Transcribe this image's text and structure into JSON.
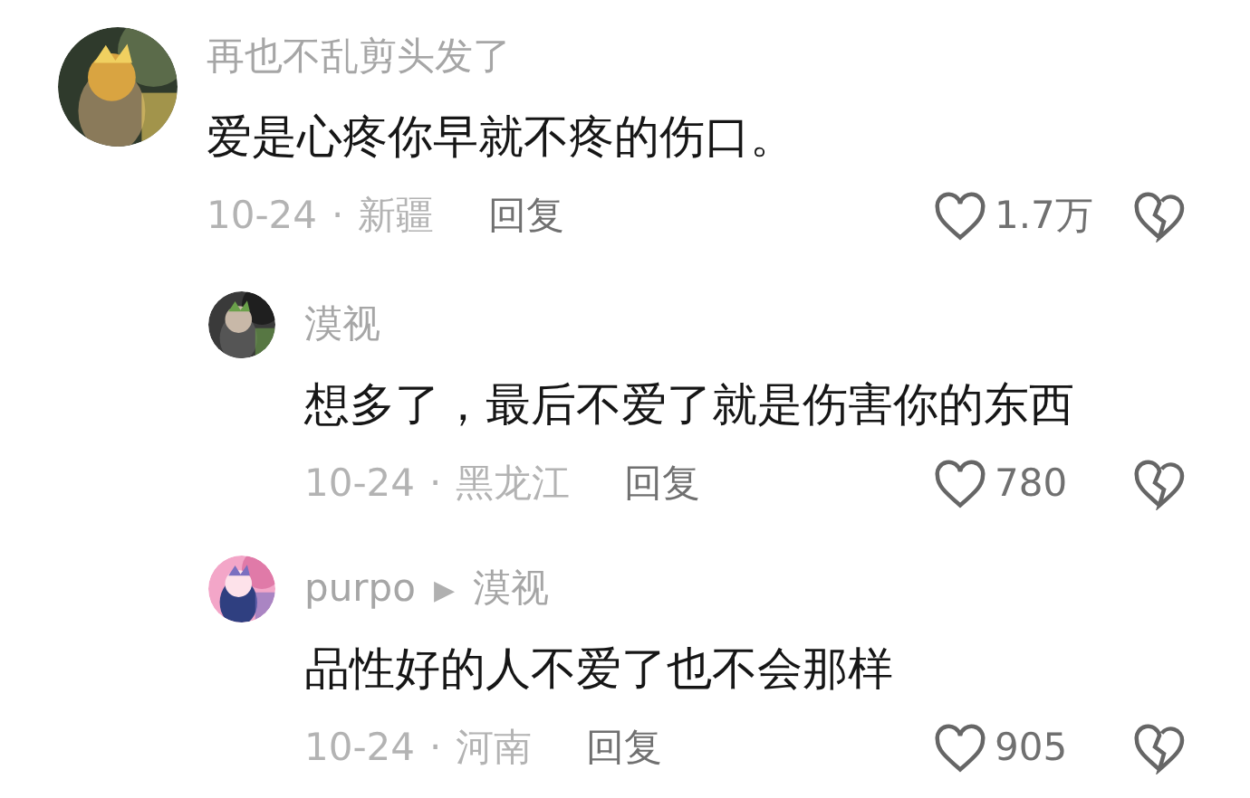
{
  "comments": [
    {
      "author": "再也不乱剪头发了",
      "text": "爱是心疼你早就不疼的伤口。",
      "date": "10-24",
      "dot": "·",
      "location": "新疆",
      "reply_label": "回复",
      "likes": "1.7万",
      "replies": [
        {
          "author": "漠视",
          "text": "想多了，最后不爱了就是伤害你的东西",
          "date": "10-24",
          "dot": "·",
          "location": "黑龙江",
          "reply_label": "回复",
          "likes": "780"
        },
        {
          "author": "purpo",
          "separator": "▶",
          "reply_to": "漠视",
          "text": "品性好的人不爱了也不会那样",
          "date": "10-24",
          "dot": "·",
          "location": "河南",
          "reply_label": "回复",
          "likes": "905"
        }
      ]
    }
  ]
}
